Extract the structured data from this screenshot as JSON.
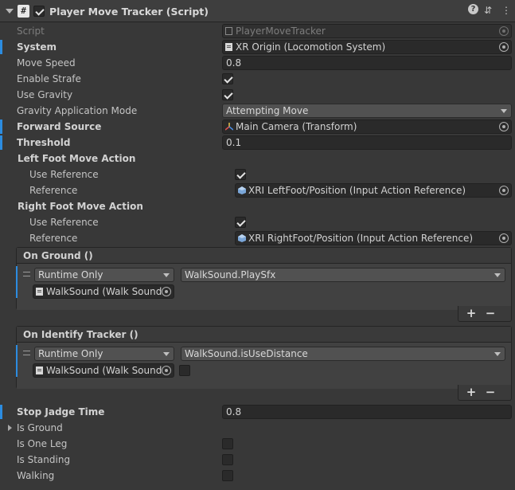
{
  "header": {
    "title": "Player Move Tracker (Script)"
  },
  "fields": {
    "script": {
      "label": "Script",
      "value": "PlayerMoveTracker"
    },
    "system": {
      "label": "System",
      "value": "XR Origin (Locomotion System)"
    },
    "move_speed": {
      "label": "Move Speed",
      "value": "0.8"
    },
    "enable_strafe": {
      "label": "Enable Strafe",
      "checked": true
    },
    "use_gravity": {
      "label": "Use Gravity",
      "checked": true
    },
    "gravity_mode": {
      "label": "Gravity Application Mode",
      "value": "Attempting Move"
    },
    "forward_source": {
      "label": "Forward Source",
      "value": "Main Camera (Transform)"
    },
    "threshold": {
      "label": "Threshold",
      "value": "0.1"
    },
    "left_foot": {
      "label": "Left Foot Move Action",
      "use_reference_label": "Use Reference",
      "use_reference": true,
      "reference_label": "Reference",
      "reference_value": "XRI LeftFoot/Position (Input Action Reference)"
    },
    "right_foot": {
      "label": "Right Foot Move Action",
      "use_reference_label": "Use Reference",
      "use_reference": true,
      "reference_label": "Reference",
      "reference_value": "XRI RightFoot/Position (Input Action Reference)"
    },
    "stop_time": {
      "label": "Stop Jadge Time",
      "value": "0.8"
    },
    "is_ground": {
      "label": "Is Ground"
    },
    "is_one_leg": {
      "label": "Is One Leg",
      "checked": false
    },
    "is_standing": {
      "label": "Is Standing",
      "checked": false
    },
    "walking": {
      "label": "Walking",
      "checked": false
    }
  },
  "events": {
    "on_ground": {
      "title": "On Ground ()",
      "runtime": "Runtime Only",
      "method": "WalkSound.PlaySfx",
      "target": "WalkSound (Walk Sound"
    },
    "on_identify": {
      "title": "On Identify Tracker ()",
      "runtime": "Runtime Only",
      "method": "WalkSound.isUseDistance",
      "target": "WalkSound (Walk Sound",
      "arg_checked": false
    }
  },
  "buttons": {
    "plus": "+",
    "minus": "−"
  },
  "icons": {
    "script": "#",
    "help": "?",
    "settings": "⇵",
    "menu": "⋮"
  },
  "colors": {
    "accent": "#2c8ce0",
    "background": "#383838"
  }
}
